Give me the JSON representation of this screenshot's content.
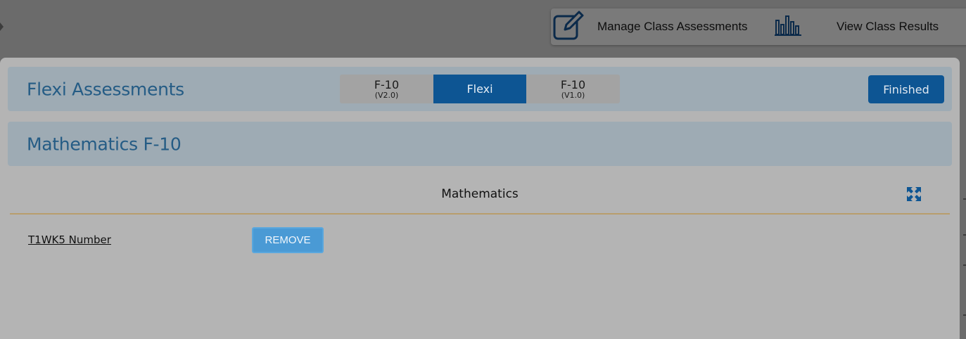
{
  "toolbar": {
    "manage_label": "Manage Class Assessments",
    "manage_icon": "edit-icon",
    "results_label": "View Class Results",
    "results_icon": "bar-chart-icon"
  },
  "header": {
    "title": "Flexi Assessments",
    "tabs": [
      {
        "label": "F-10",
        "sub": "(V2.0)",
        "active": false
      },
      {
        "label": "Flexi",
        "sub": "",
        "active": true
      },
      {
        "label": "F-10",
        "sub": "(V1.0)",
        "active": false
      }
    ],
    "finished_label": "Finished"
  },
  "curriculum": {
    "title": "Mathematics F-10"
  },
  "subject": {
    "label": "Mathematics",
    "expand_icon": "expand-icon"
  },
  "assessments": [
    {
      "name": "T1WK5 Number",
      "remove_label": "REMOVE"
    }
  ],
  "colors": {
    "accent": "#0d5593",
    "title": "#255c85",
    "remove": "#4a9ad5",
    "divider": "#b89e6c"
  }
}
